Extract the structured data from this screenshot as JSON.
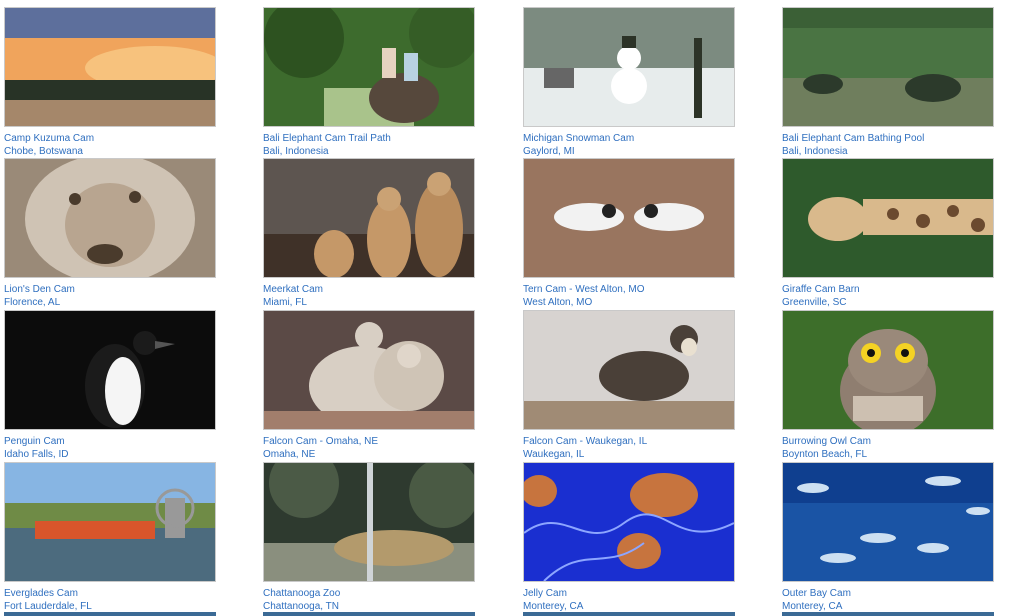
{
  "cams": [
    {
      "title": "Camp Kuzuma Cam",
      "location": "Chobe, Botswana",
      "icon": "sunset-savanna-image",
      "colors": [
        "#5d6f9c",
        "#f0a45c",
        "#283326"
      ]
    },
    {
      "title": "Bali Elephant Cam Trail Path",
      "location": "Bali, Indonesia",
      "icon": "jungle-elephant-image",
      "colors": [
        "#3d6b2d",
        "#a9c38b",
        "#56483c"
      ]
    },
    {
      "title": "Michigan Snowman Cam",
      "location": "Gaylord, MI",
      "icon": "snowman-image",
      "colors": [
        "#7c8b80",
        "#e7ecec",
        "#2c3327"
      ]
    },
    {
      "title": "Bali Elephant Cam Bathing Pool",
      "location": "Bali, Indonesia",
      "icon": "elephant-pool-image",
      "colors": [
        "#4a7443",
        "#6f7e5d",
        "#2c3a2b"
      ]
    },
    {
      "title": "Lion's Den Cam",
      "location": "Florence, AL",
      "icon": "lion-image",
      "colors": [
        "#9a8a78",
        "#cfc3b4",
        "#4a3b2c"
      ]
    },
    {
      "title": "Meerkat Cam",
      "location": "Miami, FL",
      "icon": "meerkat-image",
      "colors": [
        "#5d5550",
        "#c59868",
        "#3f3128"
      ]
    },
    {
      "title": "Tern Cam - West Alton, MO",
      "location": "West Alton, MO",
      "icon": "tern-image",
      "colors": [
        "#8a6a56",
        "#b48a6f",
        "#f2f2f2"
      ]
    },
    {
      "title": "Giraffe Cam Barn",
      "location": "Greenville, SC",
      "icon": "giraffe-image",
      "colors": [
        "#2e5a2c",
        "#d9b98c",
        "#6b4a2f"
      ]
    },
    {
      "title": "Penguin Cam",
      "location": "Idaho Falls, ID",
      "icon": "penguin-image",
      "colors": [
        "#0c0c0c",
        "#f5f5f5",
        "#1b1b1b"
      ]
    },
    {
      "title": "Falcon Cam - Omaha, NE",
      "location": "Omaha, NE",
      "icon": "falcon-chicks-image",
      "colors": [
        "#5b4a46",
        "#d8cfc4",
        "#a27e6c"
      ]
    },
    {
      "title": "Falcon Cam - Waukegan, IL",
      "location": "Waukegan, IL",
      "icon": "falcon-image",
      "colors": [
        "#d7d3d0",
        "#4a4038",
        "#a08b75"
      ]
    },
    {
      "title": "Burrowing Owl Cam",
      "location": "Boynton Beach, FL",
      "icon": "owl-image",
      "colors": [
        "#3d6e2a",
        "#8f7e70",
        "#e2d7c7"
      ]
    },
    {
      "title": "Everglades Cam",
      "location": "Fort Lauderdale, FL",
      "icon": "airboat-image",
      "colors": [
        "#87b5e3",
        "#6f8b46",
        "#d9552b"
      ]
    },
    {
      "title": "Chattanooga Zoo",
      "location": "Chattanooga, TN",
      "icon": "zoo-habitat-image",
      "colors": [
        "#2e3a2f",
        "#8a8f7e",
        "#b39a6c"
      ]
    },
    {
      "title": "Jelly Cam",
      "location": "Monterey, CA",
      "icon": "jellyfish-image",
      "colors": [
        "#1a2fd0",
        "#c7743e",
        "#8da6ff"
      ]
    },
    {
      "title": "Outer Bay Cam",
      "location": "Monterey, CA",
      "icon": "fish-school-image",
      "colors": [
        "#0f3f8f",
        "#2262b4",
        "#cde0f2"
      ]
    }
  ]
}
